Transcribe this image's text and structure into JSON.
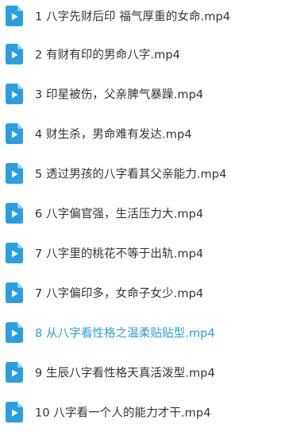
{
  "files": [
    {
      "name": "1 八字先财后印 福气厚重的女命.mp4",
      "icon": "video-file-icon"
    },
    {
      "name": "2 有财有印的男命八字.mp4",
      "icon": "video-file-icon"
    },
    {
      "name": "3 印星被伤，父亲脾气暴躁.mp4",
      "icon": "video-file-icon"
    },
    {
      "name": "4 财生杀，男命难有发达.mp4",
      "icon": "video-file-icon"
    },
    {
      "name": "5 透过男孩的八字看其父亲能力.mp4",
      "icon": "video-file-icon"
    },
    {
      "name": "6 八字偏官强，生活压力大.mp4",
      "icon": "video-file-icon"
    },
    {
      "name": "7 八字里的桃花不等于出轨.mp4",
      "icon": "video-file-icon"
    },
    {
      "name": "7 八字偏印多，女命子女少.mp4",
      "icon": "video-file-icon"
    },
    {
      "name": "8 从八字看性格之温柔贴贴型.mp4",
      "icon": "video-file-icon",
      "selected": true
    },
    {
      "name": "9 生辰八字看性格天真活泼型.mp4",
      "icon": "video-file-icon"
    },
    {
      "name": "10 八字看一个人的能力才干.mp4",
      "icon": "video-file-icon"
    }
  ],
  "colors": {
    "icon_blue": "#2a9fe0",
    "text": "#333333",
    "selected_text": "#2a9fe0"
  }
}
